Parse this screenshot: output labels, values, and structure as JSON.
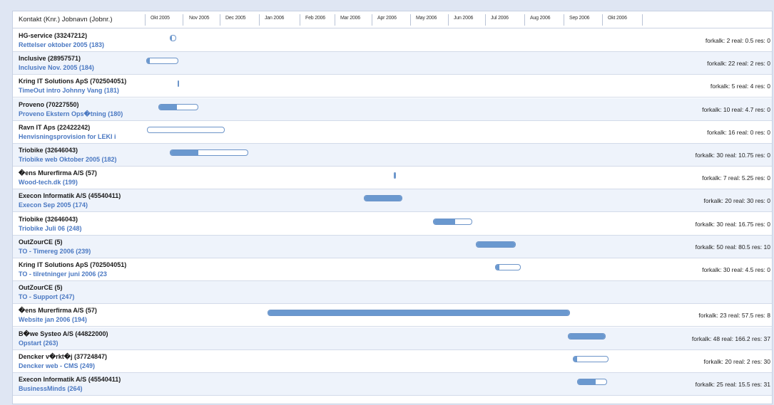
{
  "header": {
    "title": "Kontakt (Knr.) Jobnavn (Jobnr.)",
    "months": [
      "Okt 2005",
      "Nov 2005",
      "Dec 2005",
      "Jan 2006",
      "Feb 2006",
      "Mar 2006",
      "Apr 2006",
      "May 2006",
      "Jun 2006",
      "Jul 2006",
      "Aug 2006",
      "Sep 2006",
      "Okt 2006"
    ]
  },
  "rows": [
    {
      "contact": "HG-service (33247212)",
      "job": "Rettelser oktober 2005 (183)",
      "stats": "forkalk: 2 real: 0.5 res: 0",
      "progress": 0.25
    },
    {
      "contact": "Inclusive (28957571)",
      "job": "Inclusive Nov. 2005 (184)",
      "stats": "forkalk: 22 real: 2 res: 0",
      "progress": 0.09
    },
    {
      "contact": "Kring IT Solutions ApS (702504051)",
      "job": "TimeOut intro Johnny Vang (181)",
      "stats": "forkalk: 5 real: 4 res: 0",
      "progress": 0.8
    },
    {
      "contact": "Proveno (70227550)",
      "job": "Proveno Ekstern Ops�tning (180)",
      "stats": "forkalk: 10 real: 4.7 res: 0",
      "progress": 0.47
    },
    {
      "contact": "Ravn IT Aps (22422242)",
      "job": "Henvisningsprovision for LEKI i",
      "stats": "forkalk: 16 real: 0 res: 0",
      "progress": 0.0
    },
    {
      "contact": "Triobike (32646043)",
      "job": "Triobike web Oktober 2005 (182)",
      "stats": "forkalk: 30 real: 10.75 res: 0",
      "progress": 0.36
    },
    {
      "contact": "�ens Murerfirma A/S (57)",
      "job": "Wood-tech.dk (199)",
      "stats": "forkalk: 7 real: 5.25 res: 0",
      "progress": 0.75
    },
    {
      "contact": "Execon Informatik A/S (45540411)",
      "job": "Execon Sep 2005 (174)",
      "stats": "forkalk: 20 real: 30 res: 0",
      "progress": 1.0
    },
    {
      "contact": "Triobike (32646043)",
      "job": "Triobike Juli 06 (248)",
      "stats": "forkalk: 30 real: 16.75 res: 0",
      "progress": 0.56
    },
    {
      "contact": "OutZourCE (5)",
      "job": "TO - Timereg 2006 (239)",
      "stats": "forkalk: 50 real: 80.5 res: 10",
      "progress": 1.0
    },
    {
      "contact": "Kring IT Solutions ApS (702504051)",
      "job": "TO - tilretninger juni 2006 (23",
      "stats": "forkalk: 30 real: 4.5 res: 0",
      "progress": 0.15
    },
    {
      "contact": "OutZourCE (5)",
      "job": "TO - Support (247)",
      "stats": "",
      "progress": 0
    },
    {
      "contact": "�ens Murerfirma A/S (57)",
      "job": "Website jan 2006 (194)",
      "stats": "forkalk: 23 real: 57.5 res: 8",
      "progress": 1.0
    },
    {
      "contact": "B�we Systeo A/S (44822000)",
      "job": "Opstart (263)",
      "stats": "forkalk: 48 real: 166.2 res: 37",
      "progress": 1.0
    },
    {
      "contact": "Dencker v�rkt�j (37724847)",
      "job": "Dencker web - CMS (249)",
      "stats": "forkalk: 20 real: 2 res: 30",
      "progress": 0.1
    },
    {
      "contact": "Execon Informatik A/S (45540411)",
      "job": "BusinessMinds (264)",
      "stats": "forkalk: 25 real: 15.5 res: 31",
      "progress": 0.62
    }
  ]
}
